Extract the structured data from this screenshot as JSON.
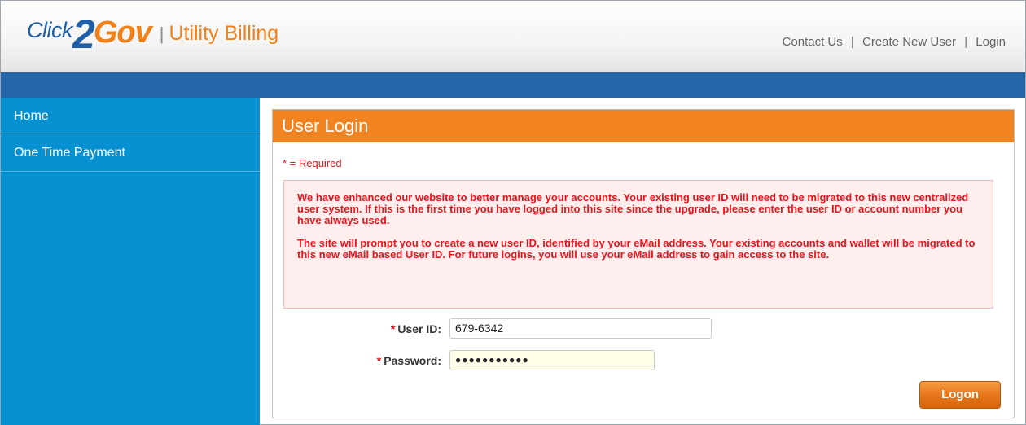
{
  "header": {
    "logo": {
      "click": "Click",
      "two": "2",
      "gov": "Gov",
      "separator": "|",
      "product": "Utility Billing"
    },
    "links": {
      "contact": "Contact Us",
      "create_user": "Create New User",
      "login": "Login",
      "pipe": "|"
    }
  },
  "sidebar": {
    "items": [
      {
        "label": "Home"
      },
      {
        "label": "One Time Payment"
      }
    ]
  },
  "panel": {
    "title": "User Login",
    "required_note": "* = Required",
    "notice": {
      "p1": "We have enhanced our website to better manage your accounts. Your existing user ID will need to be migrated to this new centralized user system. If this is the first time you have logged into this site since the upgrade, please enter the user ID or account number you have always used.",
      "p2": "The site will prompt you to create a new user ID, identified by your eMail address. Your existing accounts and wallet will be migrated to this new eMail based User ID. For future logins, you will use your eMail address to gain access to the site."
    },
    "form": {
      "required_star": "*",
      "userid_label": "User ID:",
      "userid_value": "679-6342",
      "password_label": "Password:",
      "password_value": "●●●●●●●●●●●"
    },
    "logon_label": "Logon"
  },
  "colors": {
    "brand_blue": "#1f5fa6",
    "brand_orange": "#f08018",
    "nav_blue": "#0891d1",
    "bar_blue": "#2565a8",
    "alert_red": "#e8141c"
  }
}
